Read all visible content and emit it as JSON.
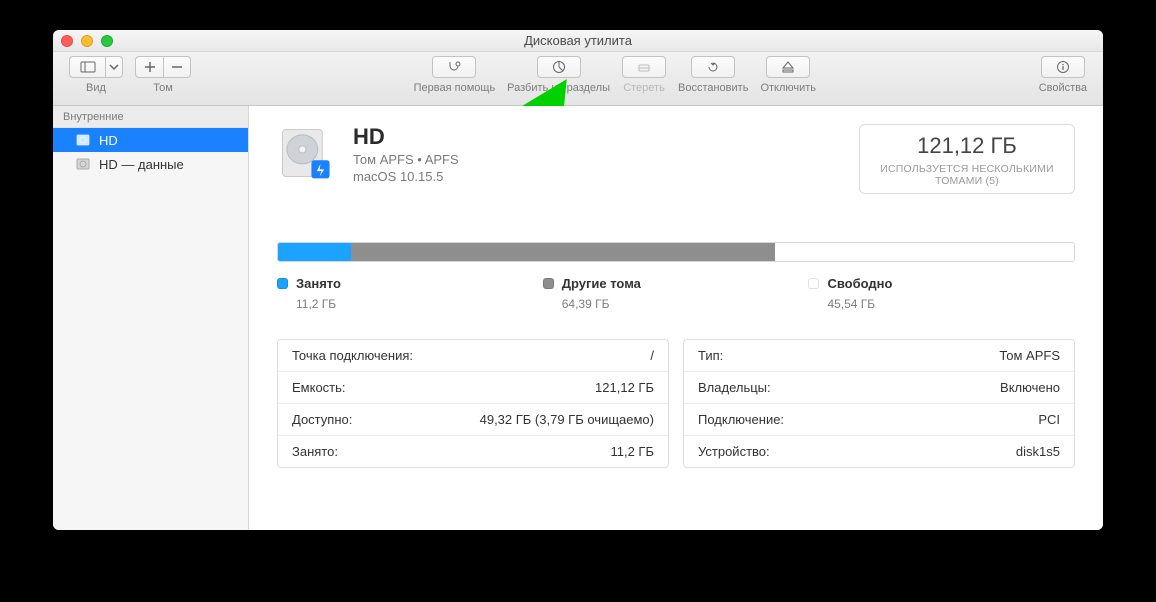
{
  "window": {
    "title": "Дисковая утилита"
  },
  "toolbar": {
    "view_label": "Вид",
    "volume_label": "Том",
    "first_aid": "Первая помощь",
    "partition": "Разбить на разделы",
    "erase": "Стереть",
    "restore": "Восстановить",
    "unmount": "Отключить",
    "info": "Свойства"
  },
  "sidebar": {
    "header": "Внутренние",
    "items": [
      {
        "name": "HD",
        "selected": true
      },
      {
        "name": "HD — данные",
        "selected": false
      }
    ]
  },
  "volume": {
    "name": "HD",
    "subtitle": "Том APFS • APFS",
    "os": "macOS 10.15.5"
  },
  "capacity": {
    "total": "121,12 ГБ",
    "shared_note": "ИСПОЛЬЗУЕТСЯ НЕСКОЛЬКИМИ ТОМАМИ (5)"
  },
  "usage": {
    "used": {
      "label": "Занято",
      "value": "11,2 ГБ",
      "pct": 9.2,
      "color": "#1aa4ff"
    },
    "other": {
      "label": "Другие тома",
      "value": "64,39 ГБ",
      "pct": 53.2,
      "color": "#8e8e8e"
    },
    "free": {
      "label": "Свободно",
      "value": "45,54 ГБ",
      "pct": 37.6,
      "color": "#ffffff"
    }
  },
  "details_left": [
    {
      "k": "Точка подключения:",
      "v": "/"
    },
    {
      "k": "Емкость:",
      "v": "121,12 ГБ"
    },
    {
      "k": "Доступно:",
      "v": "49,32 ГБ (3,79 ГБ очищаемо)"
    },
    {
      "k": "Занято:",
      "v": "11,2 ГБ"
    }
  ],
  "details_right": [
    {
      "k": "Тип:",
      "v": "Том APFS"
    },
    {
      "k": "Владельцы:",
      "v": "Включено"
    },
    {
      "k": "Подключение:",
      "v": "PCI"
    },
    {
      "k": "Устройство:",
      "v": "disk1s5"
    }
  ]
}
